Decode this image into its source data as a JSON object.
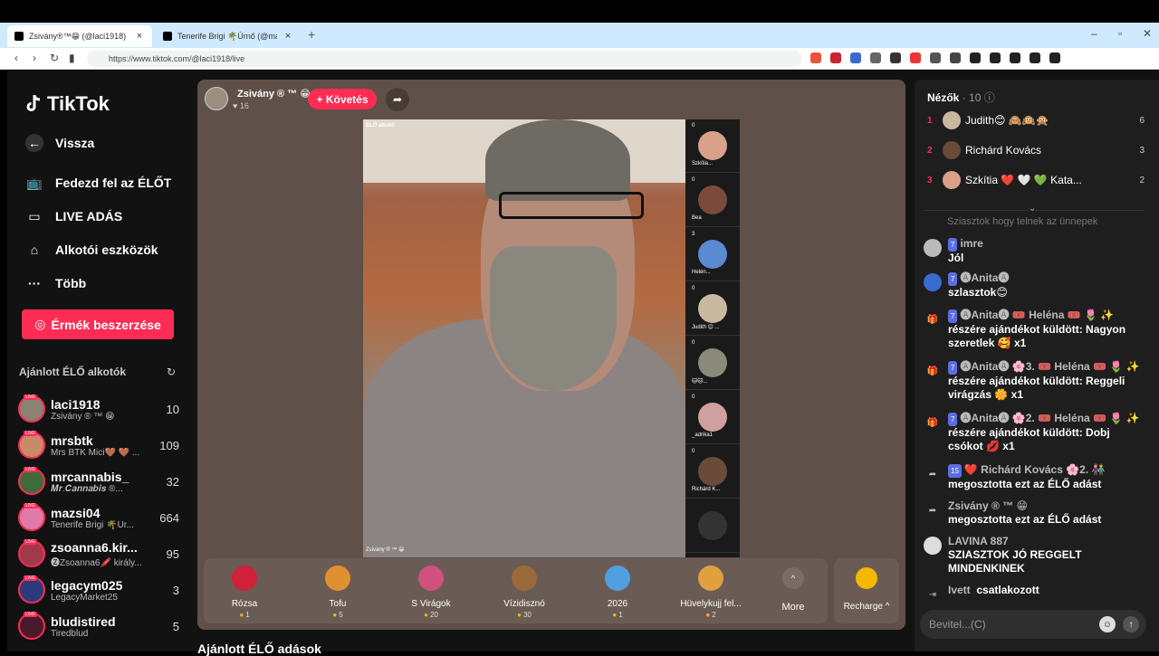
{
  "browser": {
    "tabs": [
      {
        "title": "Zsivány®™😁 (@laci1918) Él..."
      },
      {
        "title": "Tenerife Brigi 🌴Úrnő (@mazsi04) É..."
      }
    ],
    "url": "https://www.tiktok.com/@laci1918/live"
  },
  "sidebar": {
    "logo": "TikTok",
    "nav": [
      {
        "label": "Vissza",
        "icon": "back-arrow-icon"
      },
      {
        "label": "Fedezd fel az ÉLŐT",
        "icon": "tv-icon"
      },
      {
        "label": "LIVE ADÁS",
        "icon": "camera-icon"
      },
      {
        "label": "Alkotói eszközök",
        "icon": "creator-tools-icon"
      },
      {
        "label": "Több",
        "icon": "more-dots-icon"
      }
    ],
    "coins_button": "Érmék beszerzése",
    "recommended_title": "Ajánlott ÉLŐ alkotók",
    "creators": [
      {
        "name": "laci1918",
        "sub": "Zsivány ® ™ 😁",
        "count": "10",
        "color": "#8a8272"
      },
      {
        "name": "mrsbtk",
        "sub": "Mrs BTK Mici🤎 🤎 ...",
        "count": "109",
        "color": "#c98a6a"
      },
      {
        "name": "mrcannabis_",
        "sub": "𝑴𝒓.𝑪𝒂𝒏𝒏𝒂𝒃𝒊𝒔 ®...",
        "count": "32",
        "color": "#3f6a3a"
      },
      {
        "name": "mazsi04",
        "sub": "Tenerife Brigi 🌴Úr...",
        "count": "664",
        "color": "#e07aa8"
      },
      {
        "name": "zsoanna6.kir...",
        "sub": "🅩Zsoanna6🖍️ király...",
        "count": "95",
        "color": "#a03a4a"
      },
      {
        "name": "legacym025",
        "sub": "LegacyMarket25",
        "count": "3",
        "color": "#2a3a7a"
      },
      {
        "name": "bludistired",
        "sub": "Tiredblud",
        "count": "5",
        "color": "#4a1a2a"
      }
    ]
  },
  "stage": {
    "host_name": "Zsivány ® ™ 😁",
    "likes": "♥ 16",
    "follow_label": "+ Követés",
    "elo_tag": "ÉLŐ alkotó",
    "bottom_tag": "Zsivány ® ™ 😁",
    "guests": [
      {
        "count": "0",
        "name": "Szkítia...",
        "color": "#d9a08a"
      },
      {
        "count": "0",
        "name": "Bea",
        "color": "#7a4a3a"
      },
      {
        "count": "3",
        "name": "Helén...",
        "color": "#5a8ad0"
      },
      {
        "count": "0",
        "name": "Judith 😊 ...",
        "color": "#c9b8a0"
      },
      {
        "count": "0",
        "name": "🐱🐱...",
        "color": "#8a8a7a"
      },
      {
        "count": "0",
        "name": "_adrika1",
        "color": "#d0a0a0"
      },
      {
        "count": "0",
        "name": "Richárd K...",
        "color": "#6a4a3a"
      },
      {
        "count": "",
        "name": "",
        "color": "#333"
      }
    ],
    "gifts": [
      {
        "label": "Rózsa",
        "price": "1",
        "color": "#d0203a"
      },
      {
        "label": "Tofu",
        "price": "5",
        "color": "#e09030"
      },
      {
        "label": "S Virágok",
        "price": "20",
        "color": "#d05080"
      },
      {
        "label": "Vízidisznó",
        "price": "30",
        "color": "#9a6a3a"
      },
      {
        "label": "2026",
        "price": "1",
        "color": "#50a0e0"
      },
      {
        "label": "Hüvelykujj fel...",
        "price": "2",
        "color": "#e0a040"
      }
    ],
    "more_label": "More",
    "recharge_label": "Recharge ^",
    "below_title": "Ajánlott ÉLŐ adások"
  },
  "chat": {
    "viewers_title": "Nézők",
    "viewers_count": "· 10",
    "viewers": [
      {
        "rank": "1",
        "name": "Judith😊 🙈🙉🙊",
        "score": "6",
        "color": "#c9b8a0"
      },
      {
        "rank": "2",
        "name": "Richárd Kovács",
        "score": "3",
        "color": "#6a4a3a"
      },
      {
        "rank": "3",
        "name": "Szkítia ❤️ 🤍 💚 Kata...",
        "score": "2",
        "color": "#d9a08a"
      }
    ],
    "faded": "Sziasztok hogy telnek az ünnepek",
    "messages": [
      {
        "level": "7",
        "user": "imre",
        "text": "Jól",
        "icon": "avatar",
        "color": "#bbb"
      },
      {
        "level": "7",
        "user": "🅐Anita🅐",
        "text": "szlasztok😊",
        "icon": "avatar",
        "color": "#3a6ad0"
      },
      {
        "level": "7",
        "user": "🅐Anita🅐 🎟️ Heléna 🎟️ 🌷 ✨",
        "text": "részére ajándékot küldött: Nagyon szeretlek 🥰 x1",
        "icon": "gift",
        "color": "#1e1e1e"
      },
      {
        "level": "7",
        "user": "🅐Anita🅐 🌸3. 🎟️ Heléna 🎟️ 🌷 ✨",
        "text": "részére ajándékot küldött: Reggeli virágzás 🌼 x1",
        "icon": "gift",
        "color": "#1e1e1e"
      },
      {
        "level": "7",
        "user": "🅐Anita🅐 🌸2. 🎟️ Heléna 🎟️ 🌷 ✨",
        "text": "részére ajándékot küldött: Dobj csókot 💋 x1",
        "icon": "gift",
        "color": "#1e1e1e"
      },
      {
        "level": "15",
        "user": "❤️ Richárd Kovács 🌸2. 👫",
        "text": "megosztotta ezt az ÉLŐ adást",
        "icon": "share",
        "color": "#1e1e1e"
      },
      {
        "level": "",
        "user": "Zsivány ® ™ 😁",
        "text": "megosztotta ezt az ÉLŐ adást",
        "icon": "share",
        "color": "#1e1e1e"
      },
      {
        "level": "",
        "user": "LAVINA 887",
        "text": "SZIASZTOK JÓ REGGELT MINDENKINEK",
        "icon": "avatar",
        "color": "#ddd"
      },
      {
        "level": "",
        "user": "Ivett",
        "text": "csatlakozott",
        "icon": "join",
        "color": "#1e1e1e"
      }
    ],
    "input_placeholder": "Bevitel...(C)"
  }
}
